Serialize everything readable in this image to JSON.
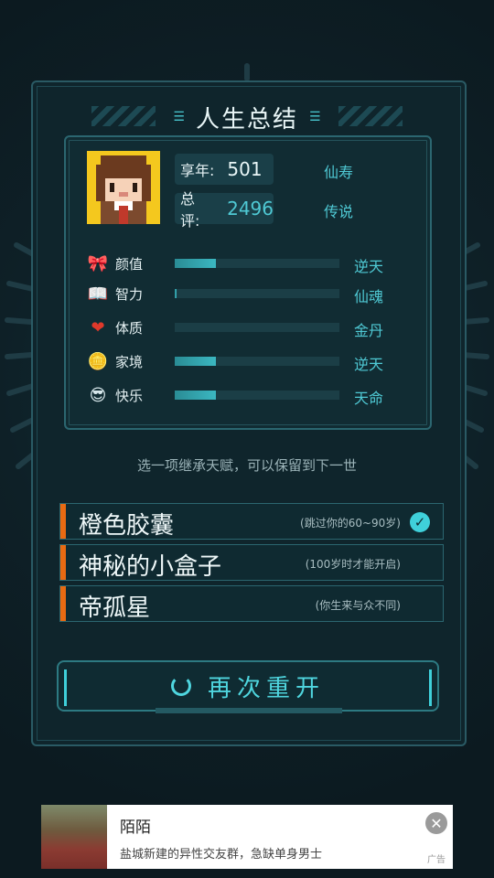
{
  "title": "人生总结",
  "summary": {
    "age_label": "享年:",
    "age_value": "501",
    "age_grade": "仙寿",
    "score_label": "总评:",
    "score_value": "2496",
    "score_grade": "传说"
  },
  "attributes": [
    {
      "icon": "bow-icon",
      "name": "颜值",
      "fill": 0.25,
      "grade": "逆天"
    },
    {
      "icon": "book-icon",
      "name": "智力",
      "fill": 0.01,
      "grade": "仙魂"
    },
    {
      "icon": "heart-icon",
      "name": "体质",
      "fill": 0.0,
      "grade": "金丹"
    },
    {
      "icon": "coin-icon",
      "name": "家境",
      "fill": 0.25,
      "grade": "逆天"
    },
    {
      "icon": "sunglasses-face-icon",
      "name": "快乐",
      "fill": 0.25,
      "grade": "天命"
    }
  ],
  "hint": "选一项继承天赋，可以保留到下一世",
  "talents": [
    {
      "name": "橙色胶囊",
      "desc": "(跳过你的60~90岁)",
      "selected": true
    },
    {
      "name": "神秘的小盒子",
      "desc": "(100岁时才能开启)",
      "selected": false
    },
    {
      "name": "帝孤星",
      "desc": "(你生来与众不同)",
      "selected": false
    }
  ],
  "restart_label": "再次重开",
  "ad": {
    "title": "陌陌",
    "desc": "盐城新建的异性交友群，急缺单身男士",
    "tag": "广告"
  },
  "colors": {
    "accent": "#4fc9d4",
    "talent_marker": "#e86a12",
    "background": "#0d1b22"
  }
}
